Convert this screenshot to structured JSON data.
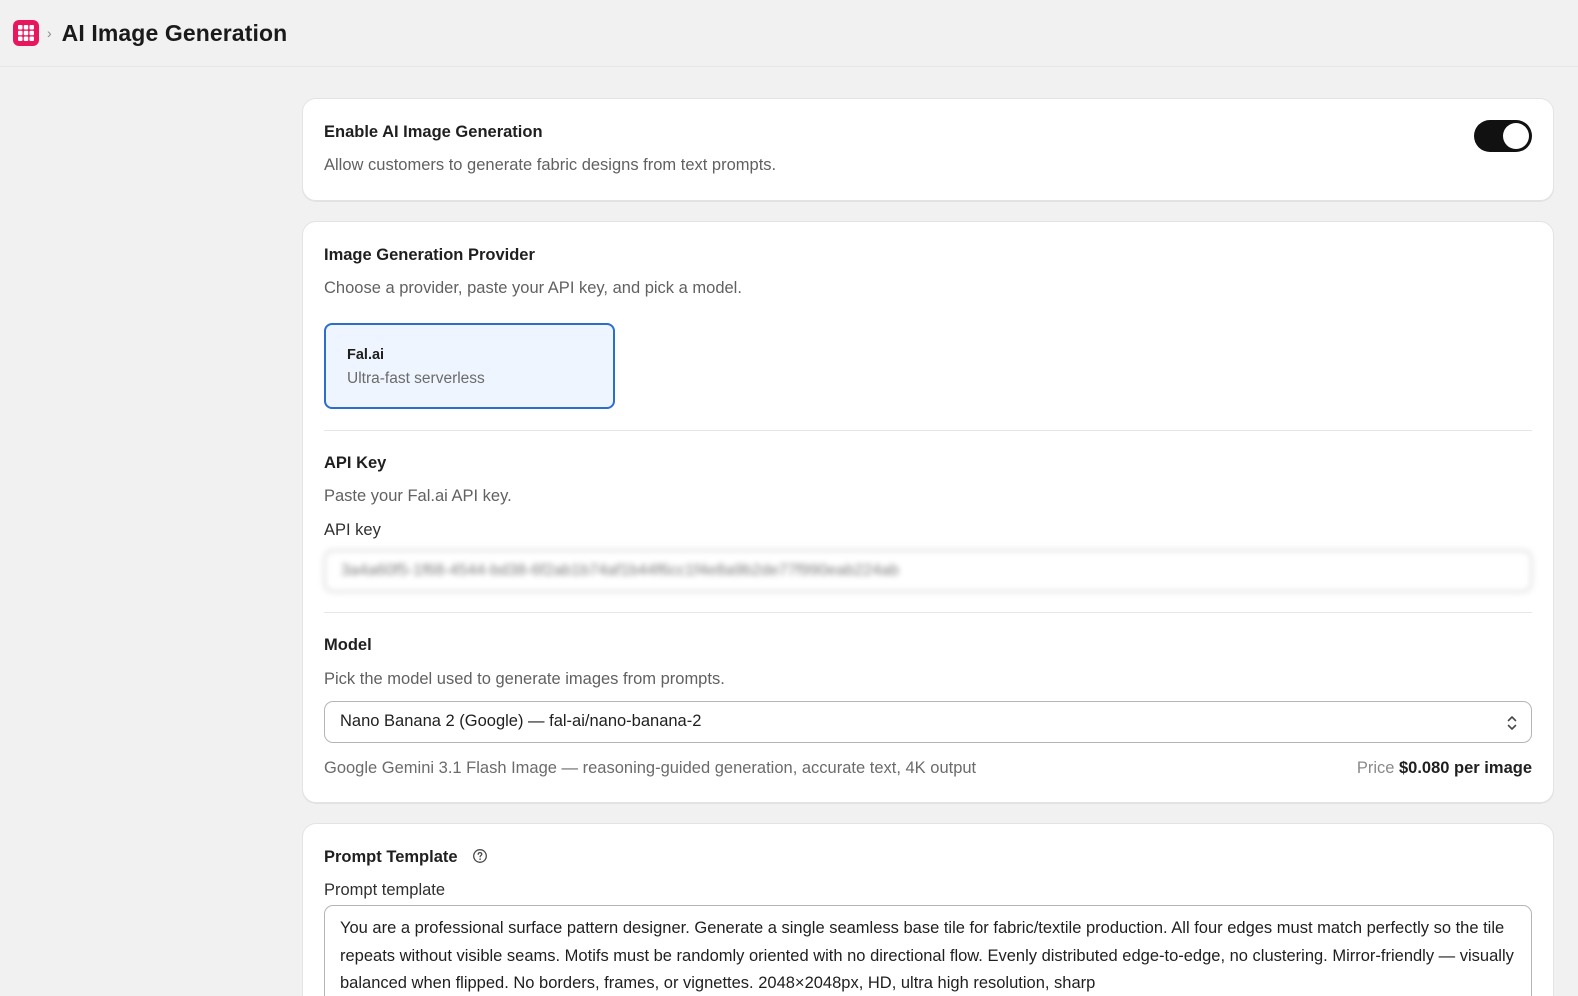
{
  "header": {
    "app_icon": "grid-app-icon",
    "separator": "›",
    "title": "AI Image Generation"
  },
  "enable": {
    "title": "Enable AI Image Generation",
    "description": "Allow customers to generate fabric designs from text prompts.",
    "enabled": true
  },
  "provider": {
    "title": "Image Generation Provider",
    "description": "Choose a provider, paste your API key, and pick a model.",
    "options": [
      {
        "name": "Fal.ai",
        "description": "Ultra-fast serverless",
        "selected": true
      }
    ]
  },
  "api_key": {
    "title": "API Key",
    "description": "Paste your Fal.ai API key.",
    "label": "API key",
    "value": "3a4a60f5-1f68-4544-bd38-6f2ab1b74af1b44f6cc1f4e8a9b2de77f990eab224ab"
  },
  "model": {
    "title": "Model",
    "description": "Pick the model used to generate images from prompts.",
    "selected": "Nano Banana 2 (Google) — fal-ai/nano-banana-2",
    "model_description": "Google Gemini 3.1 Flash Image — reasoning-guided generation, accurate text, 4K output",
    "price_label": "Price",
    "price_value": "$0.080 per image"
  },
  "prompt": {
    "title": "Prompt Template",
    "label": "Prompt template",
    "value": "You are a professional surface pattern designer. Generate a single seamless base tile for fabric/textile production. All four edges must match perfectly so the tile repeats without visible seams. Motifs must be randomly oriented with no directional flow. Evenly distributed edge-to-edge, no clustering. Mirror-friendly — visually balanced when flipped. No borders, frames, or vignettes. 2048×2048px, HD, ultra high resolution, sharp"
  },
  "colors": {
    "page_bg": "#f1f1f1",
    "app_icon": "#e8175d",
    "selected_border": "#2c6ecb",
    "selected_bg": "#eef5ff",
    "toggle_on": "#111111"
  }
}
